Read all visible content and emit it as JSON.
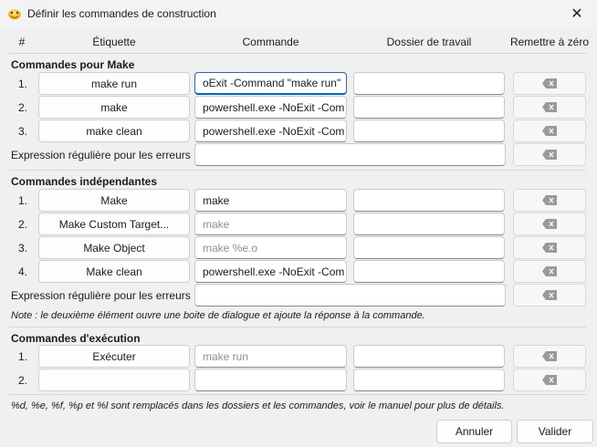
{
  "window": {
    "title": "Définir les commandes de construction",
    "close_glyph": "✕"
  },
  "columns": {
    "num": "#",
    "label": "Étiquette",
    "command": "Commande",
    "workdir": "Dossier de travail",
    "reset": "Remettre à zéro"
  },
  "make_section": {
    "title": "Commandes pour Make",
    "rows": [
      {
        "num": "1.",
        "label": "make run",
        "command": "oExit -Command \"make run\"",
        "workdir": ""
      },
      {
        "num": "2.",
        "label": "make",
        "command": "powershell.exe -NoExit -Com",
        "workdir": ""
      },
      {
        "num": "3.",
        "label": "make clean",
        "command": "powershell.exe -NoExit -Com",
        "workdir": ""
      }
    ],
    "error_regex_label": "Expression régulière pour les erreurs :",
    "error_regex_value": ""
  },
  "independent_section": {
    "title": "Commandes indépendantes",
    "rows": [
      {
        "num": "1.",
        "label": "Make",
        "command": "make",
        "command_placeholder": "",
        "workdir": ""
      },
      {
        "num": "2.",
        "label": "Make Custom Target...",
        "command": "",
        "command_placeholder": "make",
        "workdir": ""
      },
      {
        "num": "3.",
        "label": "Make Object",
        "command": "",
        "command_placeholder": "make %e.o",
        "workdir": ""
      },
      {
        "num": "4.",
        "label": "Make clean",
        "command": "powershell.exe -NoExit -Com",
        "command_placeholder": "",
        "workdir": ""
      }
    ],
    "error_regex_label": "Expression régulière pour les erreurs :",
    "error_regex_value": "",
    "note": "Note : le deuxième élément ouvre une boite de dialogue et ajoute la réponse à la commande."
  },
  "exec_section": {
    "title": "Commandes d'exécution",
    "rows": [
      {
        "num": "1.",
        "label": "Exécuter",
        "command": "",
        "command_placeholder": "make run",
        "workdir": ""
      },
      {
        "num": "2.",
        "label": "",
        "command": "",
        "command_placeholder": "",
        "workdir": ""
      }
    ]
  },
  "footer_note": "%d, %e, %f, %p et %l sont remplacés dans les dossiers et les commandes, voir le manuel pour plus de détails.",
  "buttons": {
    "cancel": "Annuler",
    "ok": "Valider"
  },
  "icons": {
    "app": "geany-app-icon",
    "clear": "backspace-clear-icon",
    "close": "close-icon"
  },
  "colors": {
    "accent": "#0067c0"
  }
}
